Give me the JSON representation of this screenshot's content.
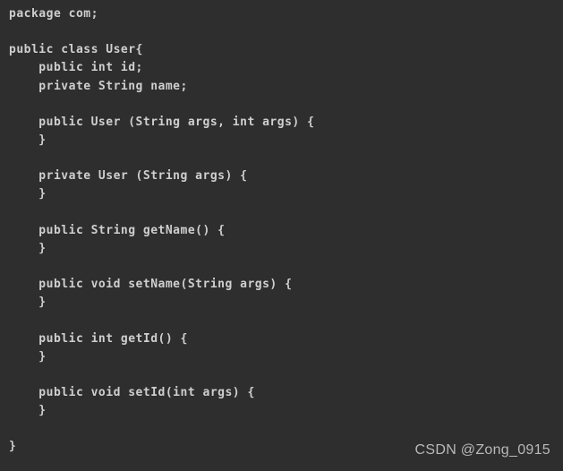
{
  "code": {
    "l1": "package com;",
    "l2": "",
    "l3": "public class User{",
    "l4": "    public int id;",
    "l5": "    private String name;",
    "l6": "",
    "l7": "    public User (String args, int args) {",
    "l8": "    }",
    "l9": "",
    "l10": "    private User (String args) {",
    "l11": "    }",
    "l12": "",
    "l13": "    public String getName() {",
    "l14": "    }",
    "l15": "",
    "l16": "    public void setName(String args) {",
    "l17": "    }",
    "l18": "",
    "l19": "    public int getId() {",
    "l20": "    }",
    "l21": "",
    "l22": "    public void setId(int args) {",
    "l23": "    }",
    "l24": "",
    "l25": "}"
  },
  "watermark": "CSDN @Zong_0915"
}
